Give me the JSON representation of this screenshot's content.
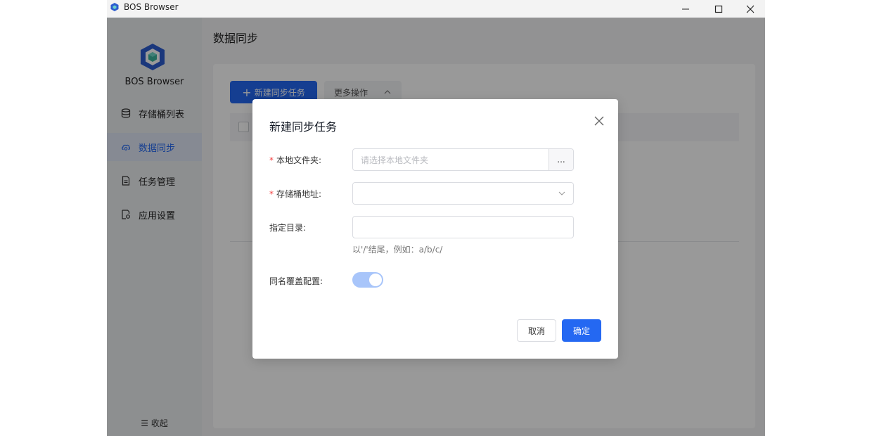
{
  "window": {
    "title": "BOS Browser",
    "controls": [
      "minimize-icon",
      "maximize-icon",
      "close-icon"
    ]
  },
  "sidebar": {
    "brand": "BOS Browser",
    "items": [
      {
        "label": "存储桶列表",
        "icon": "database-icon",
        "active": false
      },
      {
        "label": "数据同步",
        "icon": "cloud-sync-icon",
        "active": true
      },
      {
        "label": "任务管理",
        "icon": "document-icon",
        "active": false
      },
      {
        "label": "应用设置",
        "icon": "settings-file-icon",
        "active": false
      }
    ],
    "collapse_label": "收起"
  },
  "main": {
    "page_title": "数据同步",
    "toolbar": {
      "new_task_label": "新建同步任务",
      "more_label": "更多操作"
    }
  },
  "dialog": {
    "title": "新建同步任务",
    "fields": {
      "local_folder": {
        "label": "本地文件夹:",
        "required": true,
        "placeholder": "请选择本地文件夹",
        "browse_label": "..."
      },
      "bucket": {
        "label": "存储桶地址:",
        "required": true,
        "value": ""
      },
      "directory": {
        "label": "指定目录:",
        "required": false,
        "value": "",
        "hint": "以'/'结尾，例如：a/b/c/"
      },
      "overwrite": {
        "label": "同名覆盖配置:",
        "enabled": true
      }
    },
    "cancel_label": "取消",
    "confirm_label": "确定"
  },
  "colors": {
    "primary": "#2468f2",
    "required": "#f33e3e",
    "switch_on": "#a8c5fa"
  }
}
